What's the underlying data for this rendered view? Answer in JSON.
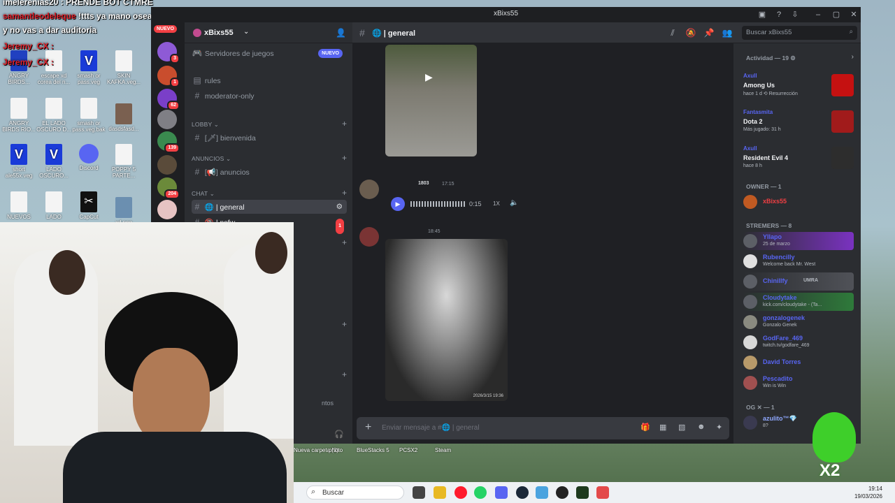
{
  "stream_overlay": {
    "line1_prefix": "imelerenias20 : PRENDE BOT CTMRE",
    "line2_name": "samantleodeleque",
    "line2_text": "!ttts ya mano osea haces auditoria",
    "line3_text": "y no vas a dar auditoria",
    "line4_name": "Jeremy_CX :",
    "line5_name": "Jeremy_CX :",
    "mascot_label": "X2"
  },
  "desktop": {
    "icons": [
      {
        "label": "ANGRY BIRDS..."
      },
      {
        "label": "escape xd corea del n..."
      },
      {
        "label": "smash or pass.veg"
      },
      {
        "label": "SKIN KAFKA.veg..."
      },
      {
        "label": "ANGRY BIRDS RIO..."
      },
      {
        "label": "EL LADO OSCURO D..."
      },
      {
        "label": "smash or pass.veg.bak"
      },
      {
        "label": "dasdsfasd..."
      },
      {
        "label": "short ale55x.veg"
      },
      {
        "label": "LADO OSCURO..."
      },
      {
        "label": "Discord"
      },
      {
        "label": "POPPY 5 PARTE..."
      },
      {
        "label": "NUEVOS"
      },
      {
        "label": "LADO"
      },
      {
        "label": "CapCut"
      },
      {
        "label": "xd.png"
      }
    ],
    "shortcuts": [
      "Nueva carpeta (3)",
      "photo",
      "BlueStacks 5",
      "PCSX2",
      "Steam"
    ]
  },
  "window": {
    "title": "xBixs55"
  },
  "guilds": {
    "nuevo_label": "NUEVO",
    "badges": [
      "3",
      "1",
      "62",
      "139",
      "204"
    ]
  },
  "server": {
    "name": "xBixs55",
    "game_servers": "Servidores de juegos",
    "game_servers_badge": "NUEVO",
    "channels_top": [
      {
        "name": "rules"
      },
      {
        "name": "moderator-only"
      }
    ],
    "categories": [
      {
        "name": "LOBBY",
        "channels": [
          "[🗡] bienvenida"
        ]
      },
      {
        "name": "ANUNCIOS",
        "channels": [
          "[📢] anuncios"
        ]
      },
      {
        "name": "CHAT",
        "channels": [
          "🌐 | general",
          "🔞 | nsfw"
        ]
      }
    ],
    "nsfw_unread": "1",
    "other_unread": "15",
    "partial_label": "ntos"
  },
  "chat": {
    "channel": "🌐 | general",
    "search_placeholder": "Buscar xBixs55",
    "audio_msg": {
      "time": "17:15",
      "duration": "0:15",
      "speed": "1X",
      "badge": "1803"
    },
    "video_msg": {
      "time": "18:45",
      "caption": "2026/3/15 19:36"
    },
    "composer_placeholder": "Enviar mensaje a #🌐 | general"
  },
  "members": {
    "activity_header": "Actividad — 19",
    "activities": [
      {
        "who": "Axull",
        "game": "Among Us",
        "sub": "hace 1 d  ⟲ Resurrección",
        "color": "#c51111"
      },
      {
        "who": "Fantasmita",
        "game": "Dota 2",
        "sub": "Más jugado: 31 h",
        "color": "#a11b1b"
      },
      {
        "who": "Axull",
        "game": "Resident Evil 4",
        "sub": "hace 8 h",
        "color": "#2d2d2d"
      }
    ],
    "owner_header": "OWNER — 1",
    "owner_name": "xBixs55",
    "streamers_header": "STREMERS — 8",
    "streamers": [
      {
        "name": "Yllapo",
        "status": "25 de marzo"
      },
      {
        "name": "Rubencilly",
        "status": "Welcome back Mr. West"
      },
      {
        "name": "Chinillfy",
        "status": "UMRA"
      },
      {
        "name": "Cloudytake",
        "status": "kick.com/cloudytake - (Ta..."
      },
      {
        "name": "gonzalogenek",
        "status": "Gonzalo Genek"
      },
      {
        "name": "GodFare_469",
        "status": "twitch.tv/godfare_469"
      },
      {
        "name": "David Torres",
        "status": ""
      },
      {
        "name": "Pescadito",
        "status": "Win is Win"
      }
    ],
    "og_header": "OG ✕ — 1",
    "og_name": "azulito™💎",
    "og_status": "8?"
  },
  "taskbar": {
    "search_placeholder": "Buscar",
    "time": "19:14",
    "date": "19/03/2026"
  }
}
